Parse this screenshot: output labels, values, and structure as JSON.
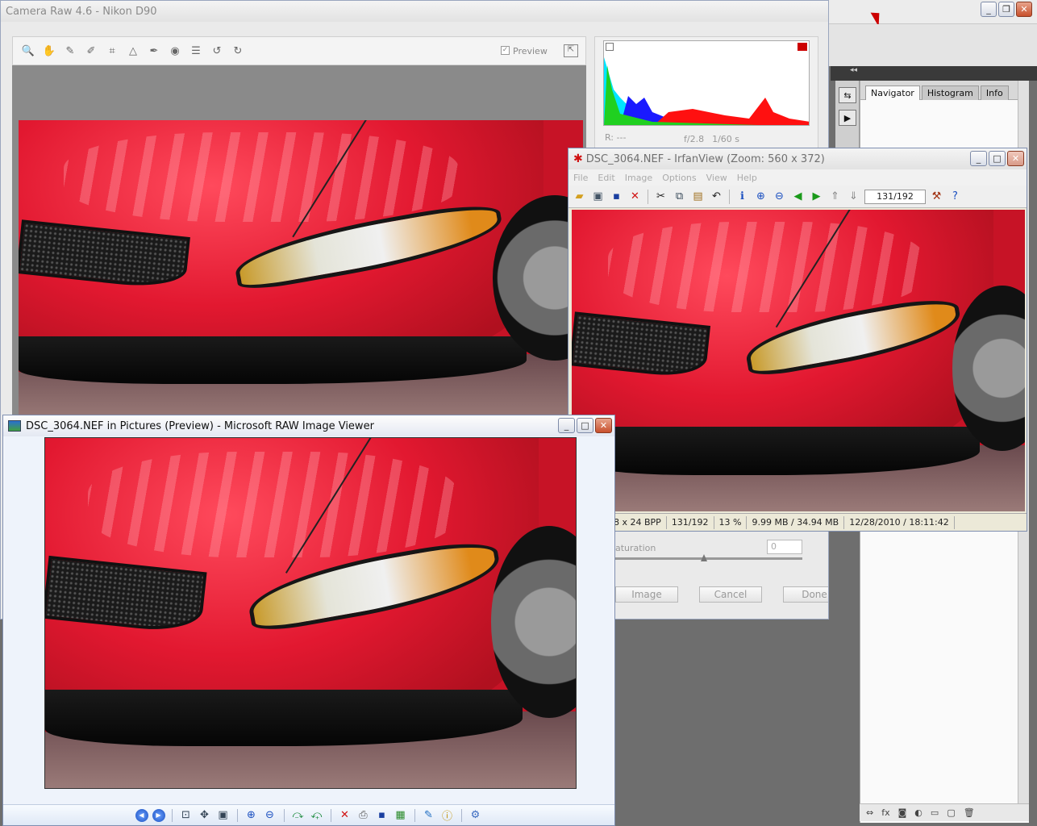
{
  "photoshop": {
    "panel_tabs": [
      "Navigator",
      "Histogram",
      "Info"
    ],
    "dock_strip": "◂◂",
    "bottom_icons": [
      "⇔",
      "fx",
      "◙",
      "◐",
      "▭",
      "▢",
      "🗑"
    ]
  },
  "camera_raw": {
    "title": "Camera Raw 4.6  -  Nikon D90",
    "preview_label": "Preview",
    "readout": {
      "r_label": "R:",
      "r_value": "---",
      "aperture": "f/2.8",
      "shutter": "1/60 s"
    },
    "saturation_label": "aturation",
    "saturation_value": "0",
    "buttons": {
      "open": "Image",
      "cancel": "Cancel",
      "done": "Done"
    }
  },
  "irfanview": {
    "title": "DSC_3064.NEF - IrfanView (Zoom: 560 x 372)",
    "menu": [
      "File",
      "Edit",
      "Image",
      "Options",
      "View",
      "Help"
    ],
    "counter": "131/192",
    "status": [
      "8 x 24 BPP",
      "131/192",
      "13 %",
      "9.99 MB / 34.94 MB",
      "12/28/2010 / 18:11:42"
    ]
  },
  "ms_raw_viewer": {
    "title": "DSC_3064.NEF in Pictures (Preview) - Microsoft RAW Image Viewer"
  },
  "colors": {
    "car_red": "#d81a2c",
    "xp_close": "#c8502c"
  }
}
